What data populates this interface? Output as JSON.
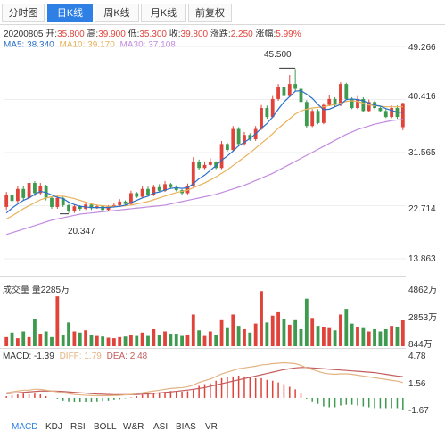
{
  "tabs": [
    {
      "label": "分时图"
    },
    {
      "label": "日K线"
    },
    {
      "label": "周K线"
    },
    {
      "label": "月K线"
    },
    {
      "label": "前复权"
    }
  ],
  "info": {
    "date": "20200805",
    "open_label": "开:",
    "open": "35.800",
    "high_label": "高:",
    "high": "39.900",
    "low_label": "低:",
    "low": "35.300",
    "close_label": "收:",
    "close": "39.800",
    "change_label": "涨跌:",
    "change": "2.250",
    "pct_label": "涨幅:",
    "pct": "5.99%"
  },
  "ma": {
    "ma5": "MA5: 38.340",
    "ma10": "MA10: 39.170",
    "ma30": "MA30: 37.108"
  },
  "volume": {
    "title": "成交量 量2285万",
    "ticks": [
      "4862万",
      "2853万",
      "844万"
    ]
  },
  "macd": {
    "macd": "MACD: -1.39",
    "diff": "DIFF: 1.79",
    "dea": "DEA: 2.48",
    "ticks": [
      "4.78",
      "1.56",
      "-1.67"
    ]
  },
  "bottom_tabs": [
    "MACD",
    "KDJ",
    "RSI",
    "BOLL",
    "W&R",
    "ASI",
    "BIAS",
    "VR"
  ],
  "colors": {
    "up": "#e0433a",
    "down": "#3d9a4f",
    "ma5": "#2b6fc7",
    "ma10": "#e8b25a",
    "ma30": "#c28be0",
    "tab_active": "#2f80e4",
    "macd_diff": "#e3b382",
    "macd_dea": "#c45c5c"
  },
  "chart_data": [
    {
      "type": "candlestick",
      "ylim": [
        13.863,
        49.266
      ],
      "y_ticks": [
        "49.266",
        "40.416",
        "31.565",
        "22.714",
        "13.863"
      ],
      "high_label": "45.500",
      "low_label": "20.347",
      "series": [
        {
          "o": 22.5,
          "c": 24.5
        },
        {
          "o": 24.5,
          "c": 23.5
        },
        {
          "o": 23.5,
          "c": 25.5
        },
        {
          "o": 25.5,
          "c": 24.0
        },
        {
          "o": 24.0,
          "c": 26.5
        },
        {
          "o": 26.5,
          "c": 24.8
        },
        {
          "o": 24.8,
          "c": 26.0
        },
        {
          "o": 26.0,
          "c": 24.0
        },
        {
          "o": 24.0,
          "c": 22.5
        },
        {
          "o": 22.5,
          "c": 24.0
        },
        {
          "o": 24.0,
          "c": 22.8
        },
        {
          "o": 22.8,
          "c": 21.8
        },
        {
          "o": 21.8,
          "c": 22.6
        },
        {
          "o": 22.6,
          "c": 22.2
        },
        {
          "o": 22.2,
          "c": 22.9
        },
        {
          "o": 22.9,
          "c": 22.3
        },
        {
          "o": 22.3,
          "c": 22.6
        },
        {
          "o": 22.6,
          "c": 22.0
        },
        {
          "o": 22.0,
          "c": 22.6
        },
        {
          "o": 22.6,
          "c": 22.8
        },
        {
          "o": 22.8,
          "c": 23.4
        },
        {
          "o": 23.4,
          "c": 23.0
        },
        {
          "o": 23.0,
          "c": 24.8
        },
        {
          "o": 24.8,
          "c": 24.2
        },
        {
          "o": 24.2,
          "c": 25.5
        },
        {
          "o": 25.5,
          "c": 24.5
        },
        {
          "o": 24.5,
          "c": 25.8
        },
        {
          "o": 25.8,
          "c": 25.2
        },
        {
          "o": 25.2,
          "c": 26.3
        },
        {
          "o": 26.3,
          "c": 25.8
        },
        {
          "o": 25.8,
          "c": 25.3
        },
        {
          "o": 25.3,
          "c": 24.8
        },
        {
          "o": 24.8,
          "c": 26.0
        },
        {
          "o": 26.0,
          "c": 30.0
        },
        {
          "o": 30.0,
          "c": 29.0
        },
        {
          "o": 29.0,
          "c": 29.5
        },
        {
          "o": 29.5,
          "c": 30.0
        },
        {
          "o": 30.0,
          "c": 29.0
        },
        {
          "o": 29.0,
          "c": 33.0
        },
        {
          "o": 33.0,
          "c": 32.0
        },
        {
          "o": 32.0,
          "c": 35.5
        },
        {
          "o": 35.5,
          "c": 33.0
        },
        {
          "o": 33.0,
          "c": 34.5
        },
        {
          "o": 34.5,
          "c": 33.8
        },
        {
          "o": 33.8,
          "c": 35.5
        },
        {
          "o": 35.5,
          "c": 39.0
        },
        {
          "o": 39.0,
          "c": 37.5
        },
        {
          "o": 37.5,
          "c": 40.5
        },
        {
          "o": 40.5,
          "c": 42.5
        },
        {
          "o": 42.5,
          "c": 41.0
        },
        {
          "o": 41.0,
          "c": 43.0
        },
        {
          "o": 43.0,
          "c": 42.2
        },
        {
          "o": 42.2,
          "c": 40.0
        },
        {
          "o": 40.0,
          "c": 36.0
        },
        {
          "o": 36.0,
          "c": 38.5
        },
        {
          "o": 38.5,
          "c": 36.5
        },
        {
          "o": 36.5,
          "c": 39.5
        },
        {
          "o": 39.5,
          "c": 40.5
        },
        {
          "o": 40.5,
          "c": 39.5
        },
        {
          "o": 39.5,
          "c": 43.0
        },
        {
          "o": 43.0,
          "c": 40.5
        },
        {
          "o": 40.5,
          "c": 39.0
        },
        {
          "o": 39.0,
          "c": 40.5
        },
        {
          "o": 40.5,
          "c": 38.5
        },
        {
          "o": 38.5,
          "c": 40.0
        },
        {
          "o": 40.0,
          "c": 39.0
        },
        {
          "o": 39.0,
          "c": 38.5
        },
        {
          "o": 38.5,
          "c": 37.5
        },
        {
          "o": 37.5,
          "c": 39.0
        },
        {
          "o": 39.0,
          "c": 37.5
        },
        {
          "o": 35.8,
          "c": 39.8
        }
      ],
      "highs": [
        25.0,
        25.0,
        26.0,
        26.0,
        27.5,
        26.8,
        26.5,
        26.2,
        24.3,
        24.5,
        24.2,
        23.0,
        22.9,
        22.8,
        23.2,
        23.1,
        22.9,
        22.8,
        22.8,
        23.1,
        23.8,
        23.6,
        25.2,
        25.0,
        25.9,
        25.9,
        26.2,
        26.3,
        26.8,
        26.5,
        26.1,
        25.5,
        26.4,
        30.8,
        30.4,
        30.1,
        30.6,
        30.1,
        33.5,
        33.2,
        36.0,
        35.8,
        35.0,
        34.8,
        36.0,
        39.5,
        39.4,
        41.0,
        43.0,
        42.8,
        44.5,
        45.5,
        42.6,
        40.3,
        38.8,
        38.8,
        39.8,
        41.2,
        40.8,
        43.3,
        43.2,
        40.8,
        41.0,
        40.8,
        40.4,
        40.2,
        39.2,
        38.8,
        39.4,
        39.4,
        39.9
      ],
      "lows": [
        22.0,
        23.0,
        23.2,
        23.5,
        23.8,
        24.3,
        24.5,
        23.6,
        22.2,
        22.2,
        22.5,
        21.5,
        21.5,
        21.9,
        22.0,
        22.0,
        22.2,
        21.8,
        21.8,
        22.4,
        22.6,
        22.8,
        22.8,
        24.0,
        24.0,
        24.3,
        24.3,
        25.0,
        25.0,
        25.5,
        25.1,
        24.5,
        24.6,
        25.8,
        28.7,
        28.8,
        29.3,
        28.8,
        28.8,
        31.7,
        31.8,
        32.8,
        32.7,
        33.5,
        33.5,
        35.3,
        37.2,
        37.3,
        40.2,
        40.8,
        40.8,
        41.8,
        39.8,
        35.7,
        35.8,
        36.3,
        36.3,
        39.3,
        39.2,
        39.3,
        40.3,
        38.8,
        38.8,
        38.3,
        38.3,
        38.8,
        38.3,
        37.3,
        37.3,
        37.2,
        35.3
      ],
      "ma5": [
        21.5,
        22.3,
        23.0,
        23.6,
        24.0,
        24.6,
        25.1,
        24.9,
        24.5,
        24.1,
        23.9,
        23.3,
        22.9,
        22.6,
        22.5,
        22.4,
        22.4,
        22.4,
        22.4,
        22.5,
        22.6,
        22.8,
        23.2,
        23.6,
        24.0,
        24.3,
        24.8,
        25.0,
        25.3,
        25.6,
        25.7,
        25.6,
        25.7,
        26.4,
        27.2,
        27.8,
        28.6,
        29.4,
        30.3,
        31.0,
        31.8,
        32.7,
        33.3,
        33.9,
        34.7,
        35.6,
        36.4,
        37.5,
        38.8,
        40.0,
        40.9,
        41.8,
        41.9,
        41.3,
        40.6,
        39.6,
        38.7,
        38.8,
        39.2,
        39.6,
        40.4,
        40.5,
        40.4,
        40.2,
        39.8,
        39.5,
        39.3,
        38.9,
        38.6,
        38.3,
        38.3
      ],
      "ma10": [
        20.5,
        21.0,
        21.6,
        22.2,
        22.7,
        23.2,
        23.7,
        24.0,
        24.2,
        24.3,
        24.3,
        24.1,
        23.9,
        23.6,
        23.3,
        23.0,
        22.8,
        22.7,
        22.6,
        22.6,
        22.6,
        22.7,
        22.8,
        23.0,
        23.2,
        23.4,
        23.7,
        24.0,
        24.3,
        24.6,
        24.9,
        25.1,
        25.3,
        25.7,
        26.1,
        26.5,
        27.0,
        27.5,
        28.1,
        28.7,
        29.4,
        30.1,
        30.8,
        31.5,
        32.3,
        33.1,
        33.9,
        34.7,
        35.6,
        36.4,
        37.2,
        38.0,
        38.5,
        38.8,
        39.0,
        39.1,
        39.2,
        39.4,
        39.6,
        39.8,
        40.1,
        40.2,
        40.1,
        39.8,
        39.5,
        39.4,
        39.3,
        39.2,
        39.2,
        39.2,
        39.2
      ],
      "ma30": [
        17.9,
        18.2,
        18.5,
        18.8,
        19.1,
        19.4,
        19.7,
        20.0,
        20.3,
        20.5,
        20.7,
        20.9,
        21.1,
        21.3,
        21.4,
        21.5,
        21.6,
        21.7,
        21.8,
        21.9,
        22.0,
        22.1,
        22.2,
        22.3,
        22.4,
        22.5,
        22.6,
        22.7,
        22.8,
        23.0,
        23.2,
        23.4,
        23.6,
        23.8,
        24.0,
        24.2,
        24.4,
        24.6,
        24.9,
        25.2,
        25.5,
        25.8,
        26.1,
        26.5,
        26.9,
        27.3,
        27.7,
        28.1,
        28.6,
        29.1,
        29.6,
        30.1,
        30.6,
        31.1,
        31.6,
        32.1,
        32.6,
        33.1,
        33.6,
        34.1,
        34.6,
        35.0,
        35.4,
        35.7,
        36.0,
        36.3,
        36.5,
        36.7,
        36.9,
        37.0,
        37.108
      ]
    },
    {
      "type": "bar",
      "title": "成交量",
      "ylim": [
        0,
        5200
      ],
      "values": [
        800,
        1200,
        700,
        1300,
        800,
        2400,
        1100,
        1300,
        800,
        4400,
        1000,
        2100,
        1300,
        1200,
        1400,
        1000,
        900,
        850,
        750,
        700,
        800,
        850,
        1000,
        900,
        1200,
        900,
        1500,
        1000,
        1300,
        1100,
        1100,
        900,
        1000,
        2800,
        1400,
        900,
        1300,
        1000,
        2300,
        1600,
        2800,
        1800,
        1500,
        1200,
        2000,
        4862,
        2100,
        2700,
        3000,
        2400,
        1900,
        2300,
        1500,
        4200,
        2500,
        1800,
        1700,
        1600,
        1400,
        2800,
        3300,
        2000,
        1700,
        1600,
        1300,
        1500,
        1300,
        1500,
        1800,
        1700,
        2285
      ]
    },
    {
      "type": "macd",
      "ylim": [
        -1.67,
        4.78
      ],
      "diff": [
        0.6,
        0.7,
        0.8,
        0.9,
        0.9,
        1.0,
        1.0,
        0.9,
        0.8,
        0.7,
        0.6,
        0.5,
        0.4,
        0.35,
        0.3,
        0.28,
        0.25,
        0.25,
        0.25,
        0.28,
        0.3,
        0.35,
        0.4,
        0.5,
        0.6,
        0.7,
        0.8,
        0.9,
        1.0,
        1.1,
        1.15,
        1.2,
        1.3,
        1.5,
        1.8,
        2.0,
        2.2,
        2.5,
        2.8,
        3.0,
        3.2,
        3.4,
        3.5,
        3.6,
        3.7,
        3.85,
        3.9,
        4.0,
        4.05,
        4.1,
        4.05,
        4.0,
        3.8,
        3.5,
        3.3,
        3.1,
        2.9,
        2.8,
        2.75,
        2.8,
        2.8,
        2.75,
        2.65,
        2.55,
        2.45,
        2.35,
        2.25,
        2.15,
        2.05,
        1.95,
        1.79
      ],
      "dea": [
        0.5,
        0.55,
        0.6,
        0.65,
        0.7,
        0.75,
        0.8,
        0.8,
        0.8,
        0.78,
        0.75,
        0.7,
        0.65,
        0.6,
        0.55,
        0.5,
        0.45,
        0.42,
        0.4,
        0.38,
        0.37,
        0.37,
        0.38,
        0.4,
        0.43,
        0.47,
        0.52,
        0.58,
        0.64,
        0.7,
        0.77,
        0.84,
        0.91,
        1.0,
        1.1,
        1.2,
        1.35,
        1.5,
        1.65,
        1.8,
        1.95,
        2.1,
        2.25,
        2.4,
        2.55,
        2.7,
        2.85,
        3.0,
        3.15,
        3.3,
        3.4,
        3.5,
        3.55,
        3.55,
        3.5,
        3.45,
        3.4,
        3.35,
        3.3,
        3.25,
        3.2,
        3.15,
        3.1,
        3.05,
        3.0,
        2.95,
        2.85,
        2.75,
        2.65,
        2.55,
        2.48
      ],
      "macd": [
        0.2,
        0.3,
        0.4,
        0.5,
        0.4,
        0.5,
        0.4,
        0.2,
        0.0,
        -0.1,
        -0.3,
        -0.4,
        -0.5,
        -0.5,
        -0.5,
        -0.45,
        -0.4,
        -0.35,
        -0.3,
        -0.2,
        -0.15,
        -0.05,
        0.05,
        0.2,
        0.35,
        0.45,
        0.55,
        0.65,
        0.72,
        0.8,
        0.76,
        0.72,
        0.78,
        1.0,
        1.4,
        1.6,
        1.7,
        2.0,
        2.3,
        2.4,
        2.5,
        2.6,
        2.5,
        2.4,
        2.3,
        2.3,
        2.1,
        2.0,
        1.8,
        1.6,
        1.3,
        1.0,
        0.5,
        -0.1,
        -0.4,
        -0.7,
        -1.0,
        -1.1,
        -1.1,
        -0.9,
        -0.8,
        -0.8,
        -0.9,
        -1.0,
        -1.1,
        -1.2,
        -1.2,
        -1.2,
        -1.2,
        -1.2,
        -1.39
      ]
    }
  ]
}
